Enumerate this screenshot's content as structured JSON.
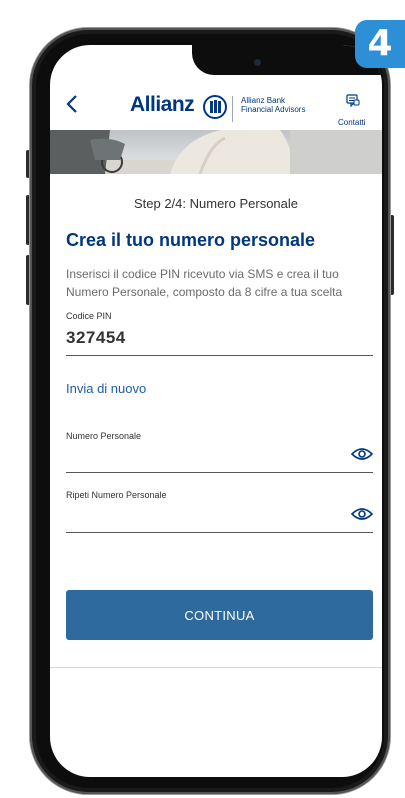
{
  "badge": {
    "number": "4"
  },
  "header": {
    "brand": "Allianz",
    "sub_line1": "Allianz Bank",
    "sub_line2": "Financial Advisors",
    "contact_label": "Contatti"
  },
  "step_label": "Step 2/4: Numero Personale",
  "title": "Crea il tuo numero personale",
  "description": "Inserisci il codice PIN ricevuto via SMS e crea il tuo Numero Personale, composto da 8 cifre a tua scelta",
  "pin": {
    "label": "Codice PIN",
    "value": "327454"
  },
  "resend_link": "Invia di nuovo",
  "personal_number": {
    "label": "Numero Personale",
    "value": ""
  },
  "repeat_number": {
    "label": "Ripeti Numero Personale",
    "value": ""
  },
  "continue_button": "CONTINUA",
  "colors": {
    "brand_blue": "#003781",
    "button": "#2f6a9f",
    "badge": "#2d8fd5",
    "link": "#1d5fa6"
  }
}
